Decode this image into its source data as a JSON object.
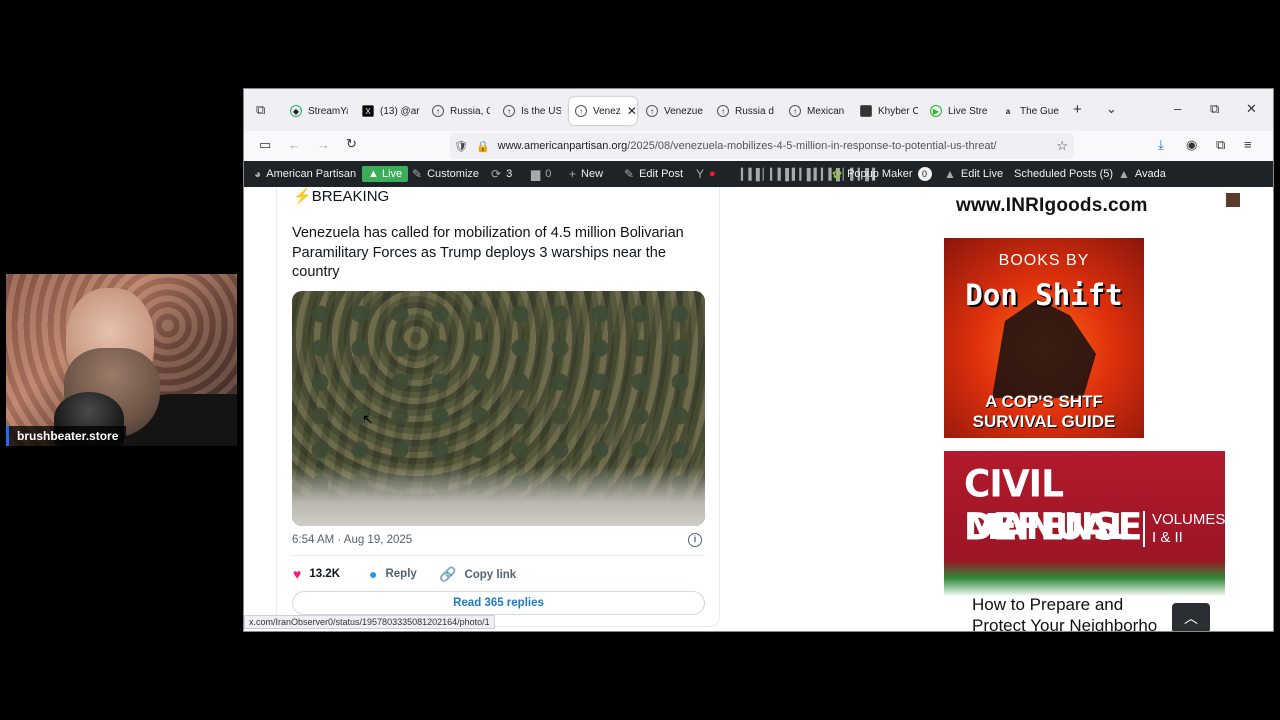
{
  "overlay": {
    "webcam_label": "brushbeater.store"
  },
  "tabs": [
    {
      "label": "StreamYa",
      "icon": "streamyard-icon"
    },
    {
      "label": "(13) @ar",
      "icon": "x-icon"
    },
    {
      "label": "Russia, C",
      "icon": "site-icon"
    },
    {
      "label": "Is the US",
      "icon": "site-icon"
    },
    {
      "label": "Venez",
      "icon": "site-icon",
      "active": true
    },
    {
      "label": "Venezue",
      "icon": "site-icon"
    },
    {
      "label": "Russia d",
      "icon": "site-icon"
    },
    {
      "label": "Mexican",
      "icon": "site-icon"
    },
    {
      "label": "Khyber C",
      "icon": "khyber-icon"
    },
    {
      "label": "Live Stre",
      "icon": "live-icon"
    },
    {
      "label": "The Gue",
      "icon": "amazon-icon"
    }
  ],
  "url": {
    "domain": "www.americanpartisan.org",
    "path": "/2025/08/venezuela-mobilizes-4-5-million-in-response-to-potential-us-threat/"
  },
  "wp_bar": {
    "site": "American Partisan",
    "live": "Live",
    "customize": "Customize",
    "updates": "3",
    "comments": "0",
    "new": "New",
    "edit_post": "Edit Post",
    "popup_maker": "Popup Maker",
    "popup_count": "0",
    "edit_live": "Edit Live",
    "scheduled": "Scheduled Posts (5)",
    "avada": "Avada"
  },
  "tweet": {
    "breaking": "BREAKING",
    "text": "Venezuela has called for mobilization of 4.5 million Bolivarian Paramilitary Forces as Trump deploys 3 warships near the country",
    "time": "6:54 AM · Aug 19, 2025",
    "likes": "13.2K",
    "reply": "Reply",
    "copy_link": "Copy link",
    "read_replies": "Read 365 replies"
  },
  "sidebar": {
    "inri": "www.INRIgoods.com",
    "books_by": "BOOKS BY",
    "author": "Don Shift",
    "book_subtitle_1": "A COP'S SHTF",
    "book_subtitle_2": "SURVIVAL GUIDE",
    "civil_1": "CIVIL DEFENSE",
    "civil_2": "MANUAL",
    "volumes_1": "VOLUMES",
    "volumes_2": "I & II",
    "how_to_1": "How to Prepare and",
    "how_to_2": "Protect Your Neighborho"
  },
  "status_url": "x.com/IranObserver0/status/1957803335081202164/photo/1"
}
